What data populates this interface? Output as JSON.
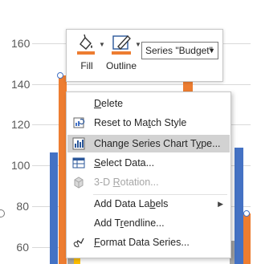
{
  "chart": {
    "y_ticks": [
      "160",
      "140",
      "120",
      "100",
      "80",
      "60"
    ],
    "colors": {
      "blue": "#4472c4",
      "orange": "#ed7d31",
      "gray": "#a5a5a5",
      "yellow": "#ffc000"
    }
  },
  "toolbar": {
    "fill_label": "Fill",
    "outline_label": "Outline",
    "series_select_value": "Series \"Budget\"",
    "fill_color": "#ed7d31",
    "outline_color": "#ed7d31"
  },
  "menu": {
    "items": [
      {
        "pre": "",
        "accel": "D",
        "post": "elete",
        "icon": "",
        "enabled": true,
        "highlight": false,
        "submenu": false
      },
      {
        "pre": "Reset to Ma",
        "accel": "t",
        "post": "ch Style",
        "icon": "reset-style-icon",
        "enabled": true,
        "highlight": false,
        "submenu": false
      },
      {
        "pre": "Change Series Chart T",
        "accel": "y",
        "post": "pe...",
        "icon": "change-chart-type-icon",
        "enabled": true,
        "highlight": true,
        "submenu": false
      },
      {
        "pre": "",
        "accel": "S",
        "post": "elect Data...",
        "icon": "select-data-icon",
        "enabled": true,
        "highlight": false,
        "submenu": false
      },
      {
        "pre": "3-D ",
        "accel": "R",
        "post": "otation...",
        "icon": "3d-rotation-icon",
        "enabled": false,
        "highlight": false,
        "submenu": false
      },
      {
        "pre": "Add Data La",
        "accel": "b",
        "post": "els",
        "icon": "",
        "enabled": true,
        "highlight": false,
        "submenu": true
      },
      {
        "pre": "Add T",
        "accel": "r",
        "post": "endline...",
        "icon": "",
        "enabled": true,
        "highlight": false,
        "submenu": false
      },
      {
        "pre": "",
        "accel": "F",
        "post": "ormat Data Series...",
        "icon": "format-data-series-icon",
        "enabled": true,
        "highlight": false,
        "submenu": false
      }
    ]
  }
}
